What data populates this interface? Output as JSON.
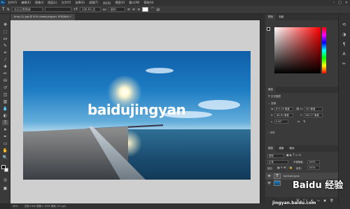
{
  "app": {
    "logo": "Ps"
  },
  "menubar": {
    "items": [
      "文件(F)",
      "编辑(E)",
      "图像(I)",
      "图层(L)",
      "文字(Y)",
      "选择(S)",
      "滤镜(T)",
      "3D(D)",
      "视图(V)",
      "窗口(W)",
      "帮助(H)"
    ]
  },
  "options": {
    "font_family": "方正正黑简体",
    "font_style": "",
    "font_size": "126.93 点",
    "anti_alias": "锐利",
    "color": "#ffffff"
  },
  "document": {
    "tab_title": "timg (1).jpg @ 50% (baidujingyan, RGB/8#) *",
    "watermark_text": "baidujingyan"
  },
  "status": {
    "zoom": "50%",
    "info": "文档:1000 像素 x 1000 像素 (72 ppi)"
  },
  "panels": {
    "color_tab": "颜色",
    "swatches_tab": "色板",
    "properties_tab": "属性",
    "text_layer_label": "文字图层",
    "transform_label": "变换",
    "w_label": "W:",
    "w_value": "671.09 像素",
    "h_label": "H:",
    "h_value": "130 像素",
    "x_label": "X:",
    "x_value": "-88.63 像素",
    "y_label": "Y:",
    "y_value": "265.27 像素",
    "angle_value": "0.00°",
    "char_label": "字符",
    "layers_tab": "图层",
    "channels_tab": "通道",
    "paths_tab": "路径",
    "filter_kind": "类型",
    "blend_mode": "正常",
    "opacity_label": "不透明度:",
    "opacity_value": "100%",
    "lock_label": "锁定:",
    "fill_label": "填充:",
    "fill_value": "100%",
    "layer_name": "baidujingyan"
  },
  "overlay": {
    "site": "jingyan.baidu.com",
    "brand": "Baidu 经验"
  }
}
